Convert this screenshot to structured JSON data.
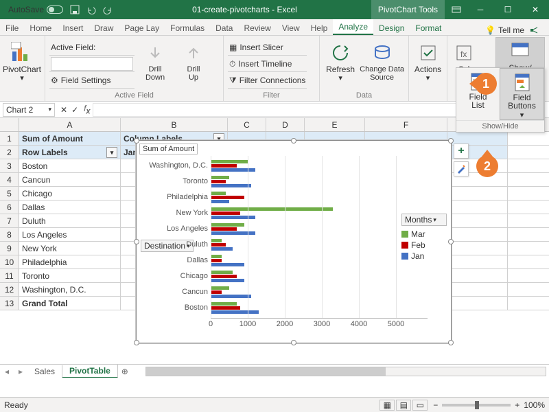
{
  "titlebar": {
    "autosave": "AutoSave",
    "title": "01-create-pivotcharts - Excel",
    "tool_tab": "PivotChart Tools"
  },
  "tabs": [
    "File",
    "Home",
    "Insert",
    "Draw",
    "Page Lay",
    "Formulas",
    "Data",
    "Review",
    "View",
    "Help",
    "Analyze",
    "Design",
    "Format"
  ],
  "tabs_active": "Analyze",
  "tellme": "Tell me",
  "ribbon": {
    "pivotchart": "PivotChart",
    "active_field_label": "Active Field:",
    "field_settings": "Field Settings",
    "drill_down": "Drill\nDown",
    "drill_up": "Drill\nUp",
    "group_active": "Active Field",
    "slicer": "Insert Slicer",
    "timeline": "Insert Timeline",
    "filter_conn": "Filter Connections",
    "group_filter": "Filter",
    "refresh": "Refresh",
    "change_src": "Change Data\nSource",
    "group_data": "Data",
    "actions": "Actions",
    "calc": "Cal",
    "showhide": "Show/\nHide",
    "field_list": "Field\nList",
    "field_buttons": "Field\nButtons",
    "popup_label": "Show/Hide"
  },
  "namebox": "Chart 2",
  "columns": [
    "A",
    "B",
    "C",
    "D",
    "E",
    "F"
  ],
  "row_numbers": [
    "1",
    "2",
    "3",
    "4",
    "5",
    "6",
    "7",
    "8",
    "9",
    "10",
    "11",
    "12",
    "13"
  ],
  "cells": {
    "a1": "Sum of Amount",
    "b1": "Column Labels",
    "a2": "Row Labels",
    "b2": "Jan",
    "a3": "Boston",
    "a4": "Cancun",
    "a5": "Chicago",
    "a6": "Dallas",
    "a7": "Duluth",
    "a8": "Los Angeles",
    "a9": "New York",
    "a10": "Philadelphia",
    "a11": "Toronto",
    "a12": "Washington, D.C.",
    "a13": "Grand Total"
  },
  "chart": {
    "title": "Sum of Amount",
    "dest_btn": "Destination",
    "legend_hdr": "Months",
    "legend": [
      "Mar",
      "Feb",
      "Jan"
    ]
  },
  "chart_data": {
    "type": "bar",
    "orientation": "horizontal",
    "categories": [
      "Washington, D.C.",
      "Toronto",
      "Philadelphia",
      "New York",
      "Los Angeles",
      "Duluth",
      "Dallas",
      "Chicago",
      "Cancun",
      "Boston"
    ],
    "series": [
      {
        "name": "Mar",
        "color": "#70AD47",
        "values": [
          1000,
          500,
          400,
          3300,
          900,
          300,
          300,
          600,
          500,
          700
        ]
      },
      {
        "name": "Feb",
        "color": "#C00000",
        "values": [
          700,
          400,
          900,
          800,
          700,
          400,
          300,
          700,
          300,
          800
        ]
      },
      {
        "name": "Jan",
        "color": "#4472C4",
        "values": [
          1200,
          1100,
          500,
          1200,
          1200,
          600,
          900,
          900,
          1100,
          1300
        ]
      }
    ],
    "xlim": [
      0,
      5000
    ],
    "xticks": [
      0,
      1000,
      2000,
      3000,
      4000,
      5000
    ]
  },
  "sheets": {
    "tabs": [
      "Sales",
      "PivotTable"
    ],
    "active": "PivotTable"
  },
  "status": {
    "ready": "Ready",
    "zoom": "100%"
  },
  "callouts": {
    "c1": "1",
    "c2": "2"
  }
}
